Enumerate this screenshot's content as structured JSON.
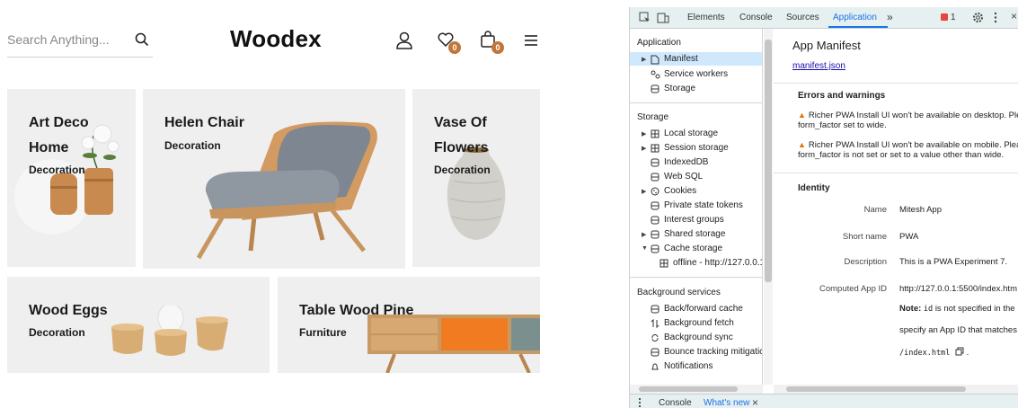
{
  "shop": {
    "search_placeholder": "Search Anything...",
    "logo": "Woodex",
    "wishlist_count": "0",
    "cart_count": "0",
    "products": [
      {
        "title_line1": "Art Deco",
        "title_line2": "Home",
        "category": "Decoration"
      },
      {
        "title_line1": "Helen Chair",
        "title_line2": "",
        "category": "Decoration"
      },
      {
        "title_line1": "Vase Of",
        "title_line2": "Flowers",
        "category": "Decoration"
      },
      {
        "title_line1": "Wood Eggs",
        "title_line2": "",
        "category": "Decoration"
      },
      {
        "title_line1": "Table Wood Pine",
        "title_line2": "",
        "category": "Furniture"
      }
    ]
  },
  "devtools": {
    "tabs": [
      "Elements",
      "Console",
      "Sources",
      "Application"
    ],
    "more_tabs": "»",
    "issue_count": "1",
    "sidebar": {
      "application": {
        "heading": "Application",
        "items": [
          "Manifest",
          "Service workers",
          "Storage"
        ]
      },
      "storage": {
        "heading": "Storage",
        "items": [
          "Local storage",
          "Session storage",
          "IndexedDB",
          "Web SQL",
          "Cookies",
          "Private state tokens",
          "Interest groups",
          "Shared storage",
          "Cache storage"
        ],
        "cache_child": "offline - http://127.0.0.1"
      },
      "background": {
        "heading": "Background services",
        "items": [
          "Back/forward cache",
          "Background fetch",
          "Background sync",
          "Bounce tracking mitigatic",
          "Notifications"
        ]
      }
    },
    "manifest": {
      "title": "App Manifest",
      "link": "manifest.json",
      "errors_heading": "Errors and warnings",
      "warnings": [
        {
          "line1": "Richer PWA Install UI won't be available on desktop. Ple",
          "line2": "form_factor set to wide."
        },
        {
          "line1": "Richer PWA Install UI won't be available on mobile. Plea",
          "line2": "form_factor is not set or set to a value other than wide."
        }
      ],
      "identity_heading": "Identity",
      "fields": [
        {
          "key": "Name",
          "value": "Mitesh App"
        },
        {
          "key": "Short name",
          "value": "PWA"
        },
        {
          "key": "Description",
          "value": "This is a PWA Experiment 7."
        },
        {
          "key": "Computed App ID",
          "value": "http://127.0.0.1:5500/index.htm"
        }
      ],
      "note_label": "Note:",
      "note_code": "id",
      "note_rest": "is not specified in the",
      "note_line2": "specify an App ID that matches",
      "note_line3": "/index.html"
    },
    "drawer": {
      "console": "Console",
      "whats_new": "What's new",
      "close": "×"
    },
    "colors": {
      "accent": "#1a73e8",
      "selected": "#cfe8fc",
      "warning": "#e37400",
      "badge": "#c0763a"
    }
  }
}
